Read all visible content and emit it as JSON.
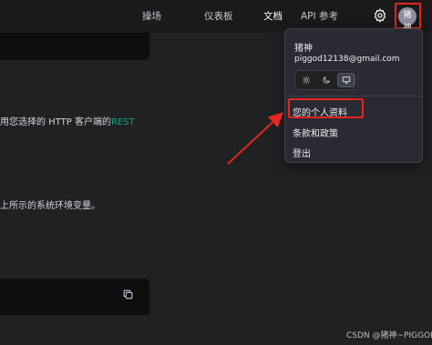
{
  "nav": {
    "items": [
      "操场",
      "仪表板",
      "文档",
      "API 参考"
    ],
    "active": "文档"
  },
  "icons": {
    "settings": "gear-icon",
    "avatar": "user-avatar",
    "copy": "copy-icon",
    "theme_light": "sun-icon",
    "theme_dark": "moon-icon",
    "theme_system": "monitor-icon"
  },
  "avatar_text": "猪神",
  "content": {
    "line1_prefix": "用您选择的 HTTP 客户端的",
    "line1_link": "REST",
    "line2": "上所示的系统环境变量。"
  },
  "menu": {
    "username": "猪神",
    "email": "piggod12138@gmail.com",
    "theme_selected": "system",
    "items": [
      "您的个人资料",
      "条款和政策",
      "登出"
    ]
  },
  "watermark": "CSDN @猪神~PIGGOD",
  "colors": {
    "accent": "#10a37f",
    "highlight": "#e5251f"
  }
}
